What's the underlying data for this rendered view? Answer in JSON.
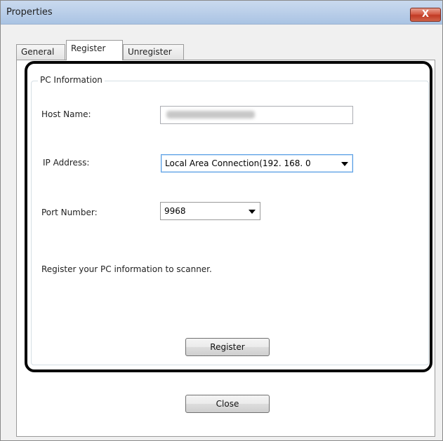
{
  "window": {
    "title": "Properties",
    "close_label": "X"
  },
  "tabs": [
    {
      "label": "General"
    },
    {
      "label": "Register"
    },
    {
      "label": "Unregister"
    }
  ],
  "group": {
    "title": "PC Information"
  },
  "fields": {
    "host_name_label": "Host Name:",
    "ip_address_label": "IP Address:",
    "ip_address_value": "Local Area Connection(192. 168. 0",
    "port_number_label": "Port Number:",
    "port_number_value": "9968"
  },
  "message": "Register your PC information to scanner.",
  "buttons": {
    "register_label": "Register",
    "close_label": "Close"
  }
}
